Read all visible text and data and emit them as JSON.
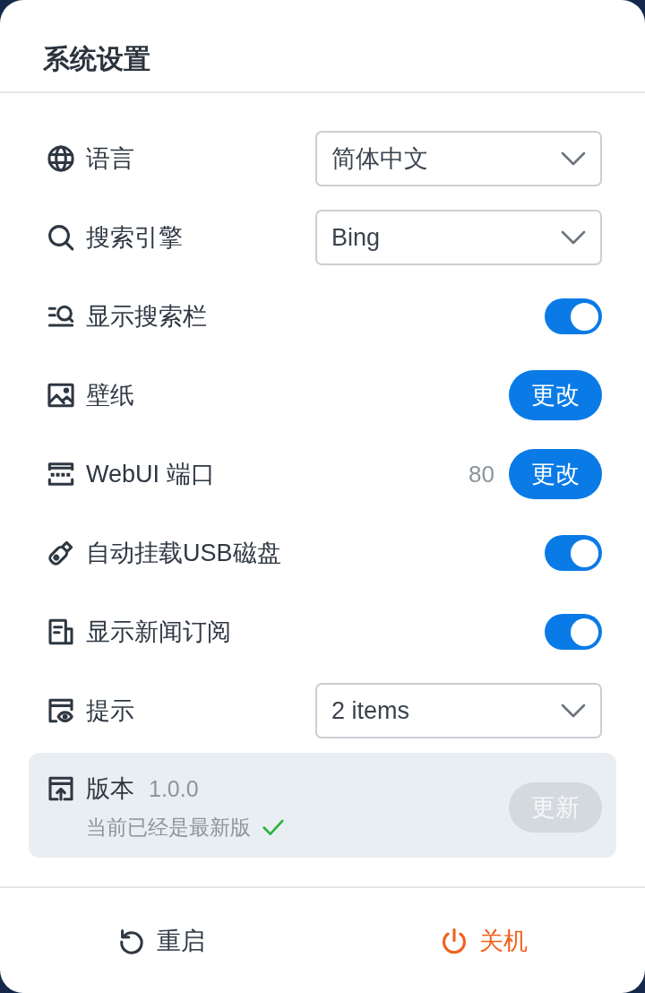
{
  "dialog": {
    "title": "系统设置"
  },
  "settings": [
    {
      "kind": "select",
      "label": "语言",
      "value": "简体中文"
    },
    {
      "kind": "select",
      "label": "搜索引擎",
      "value": "Bing"
    },
    {
      "kind": "toggle",
      "label": "显示搜索栏",
      "on": true
    },
    {
      "kind": "button",
      "label": "壁纸",
      "button": "更改"
    },
    {
      "kind": "button",
      "label": "WebUI 端口",
      "reading": "80",
      "button": "更改"
    },
    {
      "kind": "toggle",
      "label": "自动挂载USB磁盘",
      "on": true
    },
    {
      "kind": "toggle",
      "label": "显示新闻订阅",
      "on": true
    },
    {
      "kind": "select",
      "label": "提示",
      "value": "2 items"
    }
  ],
  "version": {
    "label": "版本",
    "number": "1.0.0",
    "status": "当前已经是最新版",
    "button": {
      "label": "更新",
      "disabled": true
    }
  },
  "footer": [
    {
      "kind": "restart",
      "label": "重启"
    },
    {
      "kind": "power",
      "label": "关机"
    }
  ]
}
